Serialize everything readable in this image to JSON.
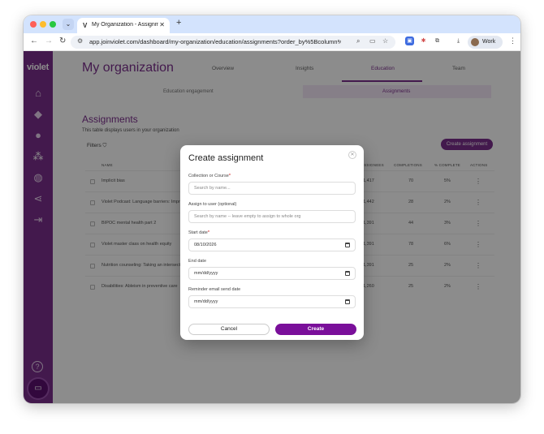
{
  "browser": {
    "tab_title": "My Organization - Assignme",
    "url": "app.joinviolet.com/dashboard/my-organization/education/assignments?order_by%5Bcolumn%5...",
    "profile_label": "Work"
  },
  "sidebar": {
    "logo": "violet"
  },
  "page": {
    "title": "My organization",
    "tabs": [
      "Overview",
      "Insights",
      "Education",
      "Team"
    ],
    "active_tab": "Education",
    "subtabs": [
      "Education engagement",
      "Assignments"
    ],
    "section_title": "Assignments",
    "section_desc": "This table displays users in your organization",
    "filters_label": "Filters",
    "create_assignment_label": "Create assignment",
    "table": {
      "headers": [
        "NAME",
        "ASSIGNEES",
        "COMPLETIONS",
        "% COMPLETE",
        "ACTIONS"
      ],
      "rows": [
        {
          "name": "Implicit bias",
          "assignees": "1,417",
          "completions": "70",
          "pct": "5%"
        },
        {
          "name": "Violet Podcast: Language barriers: Improv",
          "assignees": "1,442",
          "completions": "28",
          "pct": "2%"
        },
        {
          "name": "BIPOC mental health part 2",
          "assignees": "1,391",
          "completions": "44",
          "pct": "3%"
        },
        {
          "name": "Violet master class on health equity",
          "assignees": "1,391",
          "completions": "78",
          "pct": "6%"
        },
        {
          "name": "Nutrition counseling: Taking an intersectio",
          "assignees": "1,391",
          "completions": "25",
          "pct": "2%"
        },
        {
          "name": "Disabilities: Ableism in preventive care",
          "assignees": "1,260",
          "completions": "25",
          "pct": "2%"
        }
      ]
    }
  },
  "modal": {
    "title": "Create assignment",
    "fields": {
      "collection_label": "Collection or Course",
      "collection_placeholder": "Search by name...",
      "user_label": "Assign to user (optional)",
      "user_placeholder": "Search by name -- leave empty to assign to whole org",
      "start_label": "Start date",
      "start_value": "08/10/2026",
      "end_label": "End date",
      "end_placeholder": "mm/dd/yyyy",
      "reminder_label": "Reminder email send date",
      "reminder_placeholder": "mm/dd/yyyy"
    },
    "cancel_label": "Cancel",
    "create_label": "Create"
  },
  "icons": {
    "sidebar": [
      "home-icon",
      "graduation-cap-icon",
      "user-icon",
      "team-icon",
      "globe-icon",
      "share-icon",
      "logout-icon",
      "help-icon",
      "chat-icon"
    ]
  },
  "colors": {
    "brand": "#7b2f8c",
    "primary_button": "#7a0f9a"
  }
}
